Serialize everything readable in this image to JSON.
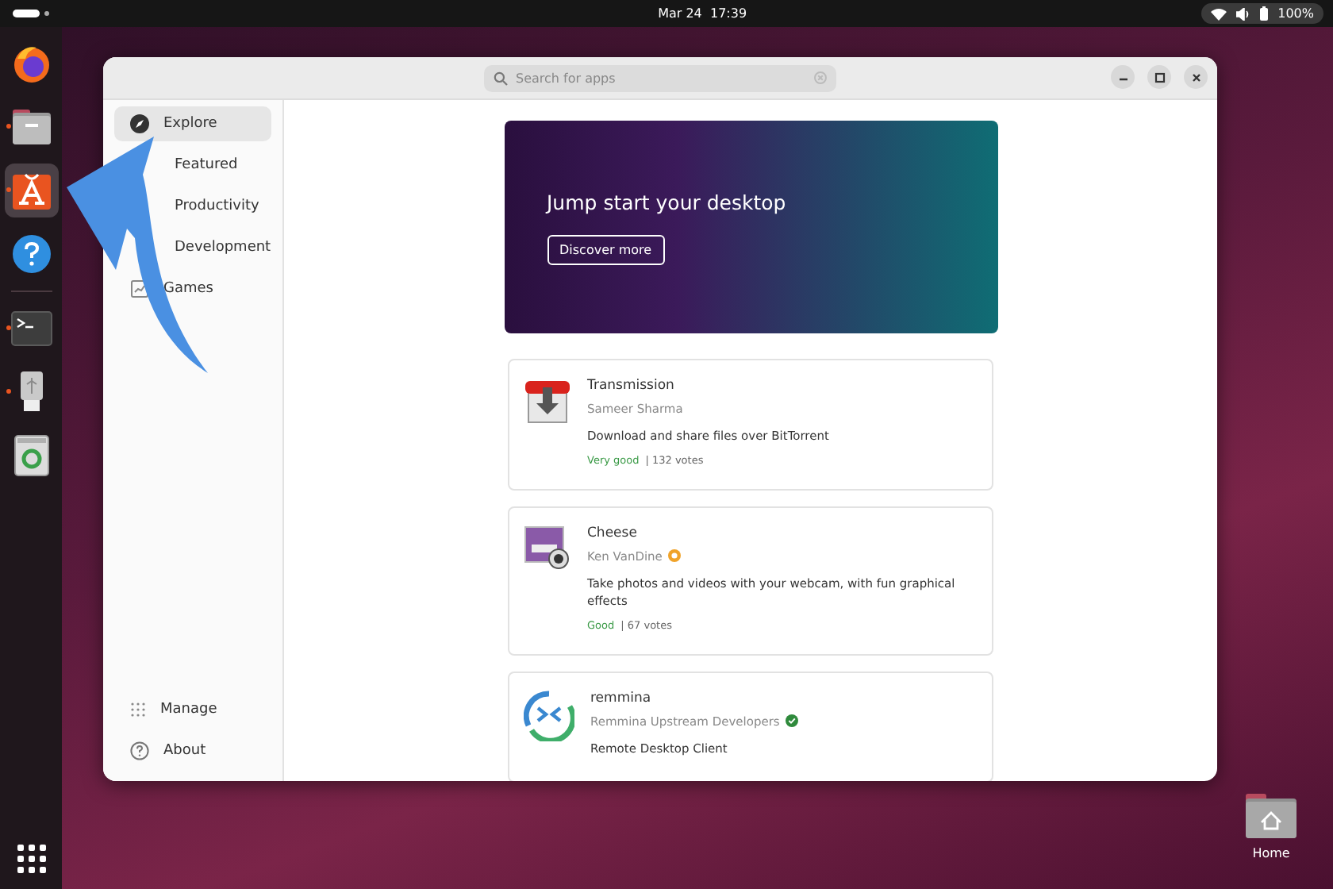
{
  "top_bar": {
    "clock": "Mar 24  17:39",
    "battery": "100%"
  },
  "dock_groups": [
    {
      "items": [
        {
          "kind": "browser",
          "running": false,
          "selected": false
        },
        {
          "kind": "files",
          "running": true,
          "selected": false
        },
        {
          "kind": "store",
          "running": true,
          "selected": true
        },
        {
          "kind": "help",
          "running": false,
          "selected": false
        }
      ]
    },
    {
      "items": [
        {
          "kind": "terminal",
          "running": true,
          "selected": false
        },
        {
          "kind": "usb",
          "running": true,
          "selected": false
        },
        {
          "kind": "trash",
          "running": false,
          "selected": false
        }
      ]
    }
  ],
  "window": {
    "search": {
      "placeholder": "Search for apps"
    }
  },
  "sidebar": {
    "items": [
      {
        "label": "Explore",
        "kind": "explore",
        "selected": true
      },
      {
        "label": "Featured",
        "kind": "hidden",
        "selected": false
      },
      {
        "label": "Productivity",
        "kind": "hidden",
        "selected": false
      },
      {
        "label": "Development",
        "kind": "hidden",
        "selected": false
      },
      {
        "label": "Games",
        "kind": "games",
        "selected": false
      }
    ],
    "footer": [
      {
        "label": "Manage",
        "kind": "manage"
      },
      {
        "label": "About",
        "kind": "about"
      }
    ]
  },
  "banner": {
    "title": "Jump start your desktop",
    "button": "Discover more"
  },
  "apps": [
    {
      "name": "Transmission",
      "kind": "transmission",
      "publisher": "Sameer Sharma",
      "description": "Download and share files over BitTorrent",
      "rating": "Very good",
      "votes": "| 132 votes"
    },
    {
      "name": "Cheese",
      "kind": "cheese",
      "publisher": "Ken VanDine",
      "badge": {
        "kind": "star",
        "color": "#f0a32a"
      },
      "description": "Take photos and videos with your webcam, with fun graphical effects",
      "rating": "Good",
      "votes": "| 67 votes"
    },
    {
      "name": "remmina",
      "kind": "remmina",
      "publisher": "Remmina Upstream Developers",
      "badge": {
        "kind": "verified",
        "color": "#2f8a3c"
      },
      "description": "Remote Desktop Client"
    }
  ],
  "desktop": {
    "home_label": "Home"
  }
}
